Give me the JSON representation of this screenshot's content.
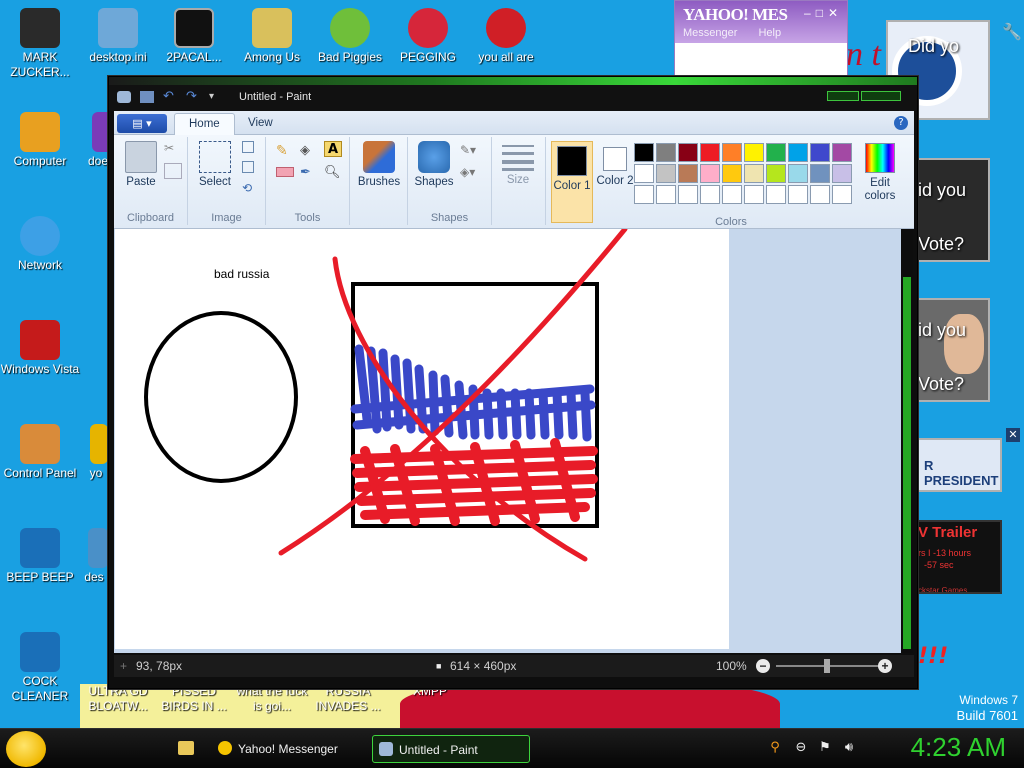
{
  "desktop": {
    "icons": [
      {
        "label": "MARK ZUCKER...",
        "color": "#2a2a2a"
      },
      {
        "label": "desktop.ini",
        "color": "#6ea8d8"
      },
      {
        "label": "2PACAL...",
        "color": "#111111"
      },
      {
        "label": "Among Us",
        "color": "#d9c05c"
      },
      {
        "label": "Bad Piggies",
        "color": "#6fbf3a"
      },
      {
        "label": "PEGGING",
        "color": "#d6263a"
      },
      {
        "label": "you all are",
        "color": "#d01f26"
      },
      {
        "label": "Computer",
        "color": "#e8a020"
      },
      {
        "label": "doe",
        "color": "#7a3bb8"
      },
      {
        "label": "Network",
        "color": "#3da0e6"
      },
      {
        "label": "Windows Vista",
        "color": "#c51b1b"
      },
      {
        "label": "Control Panel",
        "color": "#d98b3a"
      },
      {
        "label": "yo",
        "color": "#e6b400"
      },
      {
        "label": "BEEP BEEP",
        "color": "#1a6fb8"
      },
      {
        "label": "des",
        "color": "#4a90c8"
      },
      {
        "label": "COCK CLEANER",
        "color": "#1a6fb8"
      },
      {
        "label": "ULTRA GD BLOATW...",
        "color": "#ffffff"
      },
      {
        "label": "PISSED BIRDS IN ...",
        "color": "#ffffff"
      },
      {
        "label": "what the fuck is goi...",
        "color": "#ffffff"
      },
      {
        "label": "RUSSIA INVADES ...",
        "color": "#ffffff"
      },
      {
        "label": "XMPP",
        "color": "#ffffff"
      }
    ],
    "ads": {
      "did_you_1": "Did yo",
      "did_you_2": "id you",
      "vote_2": "Vote?",
      "did_you_3": "id you",
      "vote_3": "Vote?",
      "president": "R PRESIDENT",
      "trailer": "V Trailer",
      "trailer_sub1": "rs I -13 hours",
      "trailer_sub2": "-57 sec",
      "trailer_sub3": "ckstar Games",
      "bang": "!!!",
      "letter_n": "n t"
    },
    "watermark": {
      "line1": "Windows 7",
      "line2": "Build 7601"
    }
  },
  "yahoo": {
    "brand": "YAHOO! MES",
    "menu_messenger": "Messenger",
    "menu_help": "Help",
    "controls": "‒□✕"
  },
  "paint": {
    "title": "Untitled - Paint",
    "tabs": {
      "app_menu": "▤ ▾",
      "home": "Home",
      "view": "View",
      "help": "?"
    },
    "groups": {
      "clipboard": "Clipboard",
      "image": "Image",
      "tools": "Tools",
      "shapes": "Shapes",
      "colors": "Colors"
    },
    "buttons": {
      "paste": "Paste",
      "select": "Select",
      "brushes": "Brushes",
      "shapes": "Shapes",
      "size": "Size",
      "color1": "Color 1",
      "color2": "Color 2",
      "edit_colors": "Edit colors"
    },
    "palette": [
      "#000000",
      "#7f7f7f",
      "#880015",
      "#ed1c24",
      "#ff7f27",
      "#fff200",
      "#22b14c",
      "#00a2e8",
      "#3f48cc",
      "#a349a4",
      "#ffffff",
      "#c3c3c3",
      "#b97a57",
      "#ffaec9",
      "#ffc90e",
      "#efe4b0",
      "#b5e61d",
      "#99d9ea",
      "#7092be",
      "#c8bfe7",
      "#ffffff",
      "#ffffff",
      "#ffffff",
      "#ffffff",
      "#ffffff",
      "#ffffff",
      "#ffffff",
      "#ffffff",
      "#ffffff",
      "#ffffff"
    ],
    "color1_value": "#000000",
    "color2_value": "#ffffff",
    "canvas_text": "bad russia",
    "status": {
      "cursor_pos": "93, 78px",
      "image_size": "614 × 460px",
      "zoom": "100%"
    }
  },
  "taskbar": {
    "items": [
      {
        "label": "Yahoo! Messenger",
        "active": false
      },
      {
        "label": "Untitled - Paint",
        "active": true
      }
    ],
    "clock": "4:23 AM"
  }
}
